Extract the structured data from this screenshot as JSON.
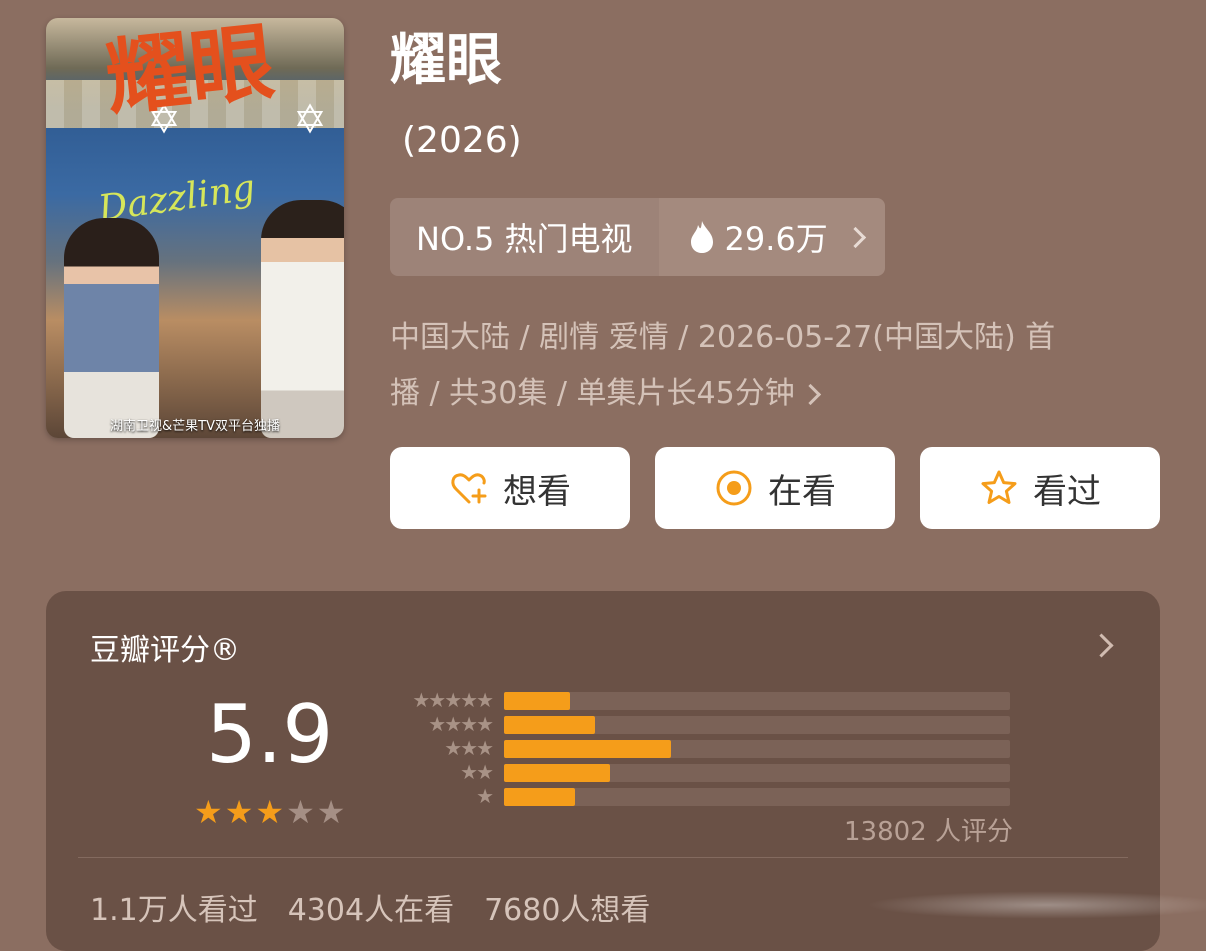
{
  "poster": {
    "title_art": "耀眼",
    "dazzling": "Dazzling",
    "bottom_text": "湖南卫视&芒果TV双平台独播"
  },
  "title": "耀眼",
  "year": "(2026)",
  "rank": {
    "label": "NO.5 热门电视",
    "heat": "29.6万"
  },
  "meta": {
    "line1": "中国大陆 / 剧情 爱情 / 2026-05-27(中国大陆) 首",
    "line2": "播 / 共30集 / 单集片长45分钟"
  },
  "actions": [
    {
      "label": "想看",
      "icon": "heart-plus-icon"
    },
    {
      "label": "在看",
      "icon": "target-icon"
    },
    {
      "label": "看过",
      "icon": "star-outline-icon"
    }
  ],
  "rating": {
    "label": "豆瓣评分®",
    "score": "5.9",
    "stars": 3,
    "max_stars": 5,
    "distribution": [
      {
        "stars": 5,
        "fraction": 0.13
      },
      {
        "stars": 4,
        "fraction": 0.18
      },
      {
        "stars": 3,
        "fraction": 0.33
      },
      {
        "stars": 2,
        "fraction": 0.21
      },
      {
        "stars": 1,
        "fraction": 0.14
      }
    ],
    "count_text": "13802 人评分"
  },
  "stats": [
    "1.1万人看过",
    "4304人在看",
    "7680人想看"
  ],
  "colors": {
    "background": "#8b6e61",
    "card": "#6a5146",
    "accent": "#f59d1a",
    "button": "#ffffff"
  }
}
